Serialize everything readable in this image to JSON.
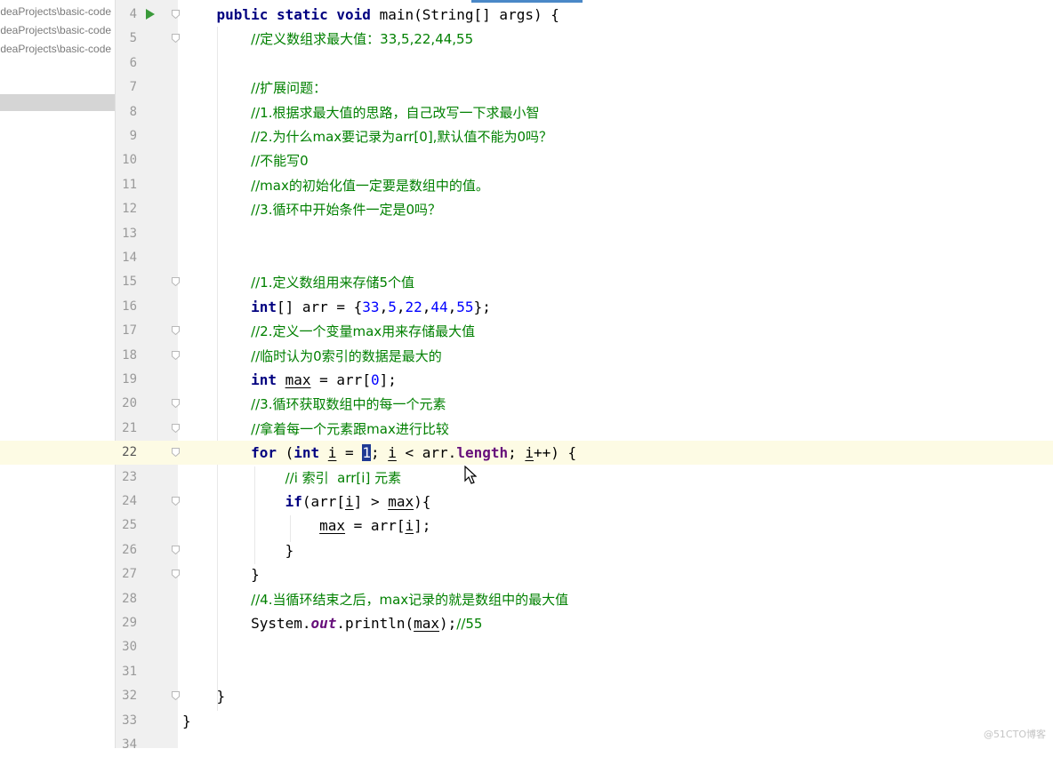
{
  "sidebar": {
    "items": [
      {
        "label": "IdeaProjects\\basic-code"
      },
      {
        "label": "IdeaProjects\\basic-code"
      },
      {
        "label": "IdeaProjects\\basic-code"
      }
    ]
  },
  "editor": {
    "current_line": 22,
    "lines": [
      {
        "n": "4",
        "text": "    public static void main(String[] args) {"
      },
      {
        "n": "5",
        "text": "        //定义数组求最大值：33,5,22,44,55"
      },
      {
        "n": "6",
        "text": ""
      },
      {
        "n": "7",
        "text": "        //扩展问题："
      },
      {
        "n": "8",
        "text": "        //1.根据求最大值的思路，自己改写一下求最小智"
      },
      {
        "n": "9",
        "text": "        //2.为什么max要记录为arr[0],默认值不能为0吗？"
      },
      {
        "n": "10",
        "text": "        //不能写0"
      },
      {
        "n": "11",
        "text": "        //max的初始化值一定要是数组中的值。"
      },
      {
        "n": "12",
        "text": "        //3.循环中开始条件一定是0吗？"
      },
      {
        "n": "13",
        "text": ""
      },
      {
        "n": "14",
        "text": ""
      },
      {
        "n": "15",
        "text": "        //1.定义数组用来存储5个值"
      },
      {
        "n": "16",
        "text": "        int[] arr = {33,5,22,44,55};"
      },
      {
        "n": "17",
        "text": "        //2.定义一个变量max用来存储最大值"
      },
      {
        "n": "18",
        "text": "        //临时认为0索引的数据是最大的"
      },
      {
        "n": "19",
        "text": "        int max = arr[0];"
      },
      {
        "n": "20",
        "text": "        //3.循环获取数组中的每一个元素"
      },
      {
        "n": "21",
        "text": "        //拿着每一个元素跟max进行比较"
      },
      {
        "n": "22",
        "text": "        for (int i = 1; i < arr.length; i++) {"
      },
      {
        "n": "23",
        "text": "            //i 索引  arr[i] 元素"
      },
      {
        "n": "24",
        "text": "            if(arr[i] > max){"
      },
      {
        "n": "25",
        "text": "                max = arr[i];"
      },
      {
        "n": "26",
        "text": "            }"
      },
      {
        "n": "27",
        "text": "        }"
      },
      {
        "n": "28",
        "text": "        //4.当循环结束之后，max记录的就是数组中的最大值"
      },
      {
        "n": "29",
        "text": "        System.out.println(max);//55"
      },
      {
        "n": "30",
        "text": ""
      },
      {
        "n": "31",
        "text": ""
      },
      {
        "n": "32",
        "text": "    }"
      },
      {
        "n": "33",
        "text": "}"
      },
      {
        "n": "34",
        "text": ""
      }
    ]
  },
  "watermark": "@51CTO博客",
  "colors": {
    "keyword": "#000080",
    "comment": "#008000",
    "number": "#0000ff",
    "field": "#660e7a",
    "current_line_bg": "#fdfbe4",
    "run_icon": "#3a9a3a"
  },
  "icons": [
    "run-icon",
    "fold-marker-icon",
    "mouse-cursor-icon"
  ]
}
